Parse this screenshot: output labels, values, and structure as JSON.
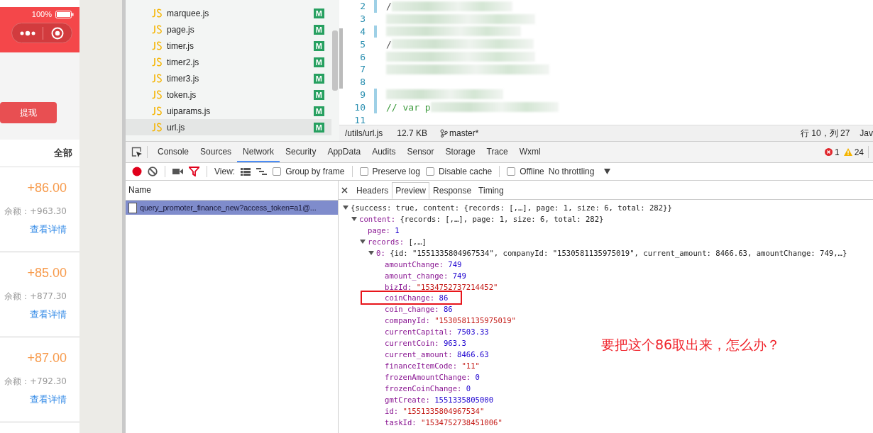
{
  "phone": {
    "battery": "100%",
    "withdraw_button": "提现",
    "filter": "全部",
    "records": [
      {
        "amount": "+86.00",
        "balance": "余额：+963.30",
        "link": "查看详情"
      },
      {
        "amount": "+85.00",
        "balance": "余额：+877.30",
        "link": "查看详情"
      },
      {
        "amount": "+87.00",
        "balance": "余额：+792.30",
        "link": "查看详情"
      }
    ]
  },
  "file_tree": {
    "items": [
      {
        "name": "marquee.js",
        "badge": "M",
        "selected": false
      },
      {
        "name": "page.js",
        "badge": "M",
        "selected": false
      },
      {
        "name": "timer.js",
        "badge": "M",
        "selected": false
      },
      {
        "name": "timer2.js",
        "badge": "M",
        "selected": false
      },
      {
        "name": "timer3.js",
        "badge": "M",
        "selected": false
      },
      {
        "name": "token.js",
        "badge": "M",
        "selected": false
      },
      {
        "name": "uiparams.js",
        "badge": "M",
        "selected": false
      },
      {
        "name": "url.js",
        "badge": "M",
        "selected": true
      }
    ]
  },
  "editor": {
    "lines": [
      {
        "num": "2",
        "text": "/",
        "kind": "plain",
        "blurred": true,
        "changed": true
      },
      {
        "num": "3",
        "blurred": true,
        "changed": false
      },
      {
        "num": "4",
        "blurred": true,
        "changed": true
      },
      {
        "num": "5",
        "text": "/",
        "kind": "plain",
        "blurred": true,
        "changed": false
      },
      {
        "num": "6",
        "blurred": true,
        "changed": false
      },
      {
        "num": "7",
        "blurred": true,
        "changed": false
      },
      {
        "num": "8",
        "blurred": false,
        "changed": false
      },
      {
        "num": "9",
        "blurred": true,
        "changed": true
      },
      {
        "num": "10",
        "text": "// var p",
        "kind": "comment",
        "blurred": true,
        "changed": true
      },
      {
        "num": "11",
        "blurred": false,
        "changed": false
      }
    ],
    "status_bar": {
      "path": "/utils/url.js",
      "size": "12.7 KB",
      "branch": "master*",
      "position": "行 10，列 27",
      "language": "Jav"
    }
  },
  "devtools": {
    "tabs": [
      {
        "label": "Console",
        "selected": false
      },
      {
        "label": "Sources",
        "selected": false
      },
      {
        "label": "Network",
        "selected": true
      },
      {
        "label": "Security",
        "selected": false
      },
      {
        "label": "AppData",
        "selected": false
      },
      {
        "label": "Audits",
        "selected": false
      },
      {
        "label": "Sensor",
        "selected": false
      },
      {
        "label": "Storage",
        "selected": false
      },
      {
        "label": "Trace",
        "selected": false
      },
      {
        "label": "Wxml",
        "selected": false
      }
    ],
    "errors": "1",
    "warnings": "24",
    "toolbar": {
      "recording": true,
      "view_label": "View:",
      "options": [
        {
          "label": "Group by frame",
          "checked": false
        },
        {
          "label": "Preserve log",
          "checked": false
        },
        {
          "label": "Disable cache",
          "checked": false
        },
        {
          "label": "Offline",
          "checked": false
        }
      ],
      "throttling": "No throttling"
    },
    "requests": {
      "header": "Name",
      "rows": [
        {
          "name": "query_promoter_finance_new?access_token=a1@...",
          "selected": true
        }
      ]
    },
    "detail_tabs": [
      {
        "label": "Headers",
        "selected": false
      },
      {
        "label": "Preview",
        "selected": true
      },
      {
        "label": "Response",
        "selected": false
      },
      {
        "label": "Timing",
        "selected": false
      }
    ],
    "preview": {
      "tree": [
        {
          "value": "{success: true, content: {records: [,…], page: 1, size: 6, total: 282}}",
          "kind": "object",
          "expanded": true,
          "highlighted": false,
          "children": [
            {
              "key": "content:",
              "value": "{records: [,…], page: 1, size: 6, total: 282}",
              "kind": "object",
              "expanded": true,
              "highlighted": false,
              "children": [
                {
                  "key": "page:",
                  "value": "1",
                  "kind": "number",
                  "highlighted": false
                },
                {
                  "key": "records:",
                  "value": "[,…]",
                  "kind": "object",
                  "expanded": true,
                  "highlighted": false,
                  "children": [
                    {
                      "key": "0:",
                      "value": "{id: \"1551335804967534\", companyId: \"1530581135975019\", current_amount: 8466.63, amountChange: 749,…}",
                      "kind": "object",
                      "expanded": true,
                      "highlighted": false,
                      "children": [
                        {
                          "key": "amountChange:",
                          "value": "749",
                          "kind": "number",
                          "highlighted": false
                        },
                        {
                          "key": "amount_change:",
                          "value": "749",
                          "kind": "number",
                          "highlighted": false
                        },
                        {
                          "key": "bizId:",
                          "value": "\"1534752737214452\"",
                          "kind": "string",
                          "highlighted": false
                        },
                        {
                          "key": "coinChange:",
                          "value": "86",
                          "kind": "number",
                          "highlighted": true
                        },
                        {
                          "key": "coin_change:",
                          "value": "86",
                          "kind": "number",
                          "highlighted": false
                        },
                        {
                          "key": "companyId:",
                          "value": "\"1530581135975019\"",
                          "kind": "string",
                          "highlighted": false
                        },
                        {
                          "key": "currentCapital:",
                          "value": "7503.33",
                          "kind": "number",
                          "highlighted": false
                        },
                        {
                          "key": "currentCoin:",
                          "value": "963.3",
                          "kind": "number",
                          "highlighted": false
                        },
                        {
                          "key": "current_amount:",
                          "value": "8466.63",
                          "kind": "number",
                          "highlighted": false
                        },
                        {
                          "key": "financeItemCode:",
                          "value": "\"11\"",
                          "kind": "string",
                          "highlighted": false
                        },
                        {
                          "key": "frozenAmountChange:",
                          "value": "0",
                          "kind": "number",
                          "highlighted": false
                        },
                        {
                          "key": "frozenCoinChange:",
                          "value": "0",
                          "kind": "number",
                          "highlighted": false
                        },
                        {
                          "key": "gmtCreate:",
                          "value": "1551335805000",
                          "kind": "number",
                          "highlighted": false
                        },
                        {
                          "key": "id:",
                          "value": "\"1551335804967534\"",
                          "kind": "string",
                          "highlighted": false
                        },
                        {
                          "key": "taskId:",
                          "value": "\"1534752738451006\"",
                          "kind": "string",
                          "highlighted": false
                        }
                      ]
                    }
                  ]
                }
              ]
            }
          ]
        }
      ],
      "annotation": "要把这个86取出来，怎么办？"
    }
  }
}
